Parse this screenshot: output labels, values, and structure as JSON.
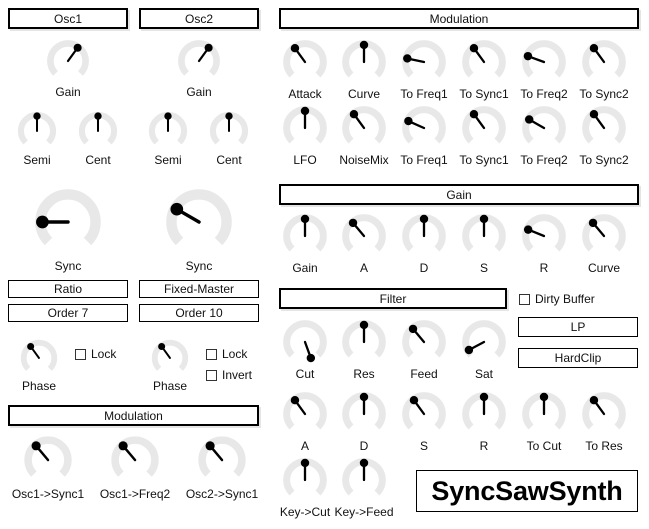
{
  "app": {
    "title": "SyncSawSynth",
    "logo_label": "SyncSawSynth"
  },
  "colors": {
    "background": "#ffffff",
    "knob_arc": "#e8e8e8",
    "knob_needle": "#000000",
    "border": "#000000",
    "text": "#111111"
  },
  "sections": {
    "osc1": {
      "label": "Osc1"
    },
    "osc2": {
      "label": "Osc2"
    },
    "modulation_left": {
      "label": "Modulation"
    },
    "modulation_right": {
      "label": "Modulation"
    },
    "gain": {
      "label": "Gain"
    },
    "filter": {
      "label": "Filter"
    }
  },
  "osc1": {
    "knobs": [
      {
        "name": "gain",
        "label": "Gain",
        "angle": 36
      },
      {
        "name": "semi",
        "label": "Semi",
        "angle": 0
      },
      {
        "name": "cent",
        "label": "Cent",
        "angle": 0
      },
      {
        "name": "sync",
        "label": "Sync",
        "angle": -90
      }
    ],
    "buttons": [
      {
        "name": "sync-type",
        "label": "Ratio"
      },
      {
        "name": "spectrum-order",
        "label": "Order 7"
      }
    ],
    "phase": {
      "name": "phase",
      "label": "Phase",
      "angle": -36
    },
    "checkboxes": [
      {
        "name": "lock",
        "label": "Lock",
        "checked": false
      }
    ]
  },
  "osc2": {
    "knobs": [
      {
        "name": "gain",
        "label": "Gain",
        "angle": 36
      },
      {
        "name": "semi",
        "label": "Semi",
        "angle": 0
      },
      {
        "name": "cent",
        "label": "Cent",
        "angle": 0
      },
      {
        "name": "sync",
        "label": "Sync",
        "angle": -60
      }
    ],
    "buttons": [
      {
        "name": "sync-type",
        "label": "Fixed-Master"
      },
      {
        "name": "spectrum-order",
        "label": "Order 10"
      }
    ],
    "phase": {
      "name": "phase",
      "label": "Phase",
      "angle": -36
    },
    "checkboxes": [
      {
        "name": "lock",
        "label": "Lock",
        "checked": false
      },
      {
        "name": "invert",
        "label": "Invert",
        "checked": false
      }
    ]
  },
  "modulation_left": {
    "knobs": [
      {
        "name": "osc1-to-sync1",
        "label": "Osc1->Sync1",
        "angle": -40
      },
      {
        "name": "osc1-to-freq2",
        "label": "Osc1->Freq2",
        "angle": -40
      },
      {
        "name": "osc2-to-sync1",
        "label": "Osc2->Sync1",
        "angle": -40
      }
    ]
  },
  "modulation_right": {
    "row1": [
      {
        "name": "attack",
        "label": "Attack",
        "angle": -36
      },
      {
        "name": "curve",
        "label": "Curve",
        "angle": 0
      },
      {
        "name": "to-freq1-a",
        "label": "To Freq1",
        "angle": -78
      },
      {
        "name": "to-sync1-a",
        "label": "To Sync1",
        "angle": -36
      },
      {
        "name": "to-freq2-a",
        "label": "To Freq2",
        "angle": -70
      },
      {
        "name": "to-sync2-a",
        "label": "To Sync2",
        "angle": -36
      }
    ],
    "row2": [
      {
        "name": "lfo",
        "label": "LFO",
        "angle": 0
      },
      {
        "name": "noisemix",
        "label": "NoiseMix",
        "angle": -36
      },
      {
        "name": "to-freq1-b",
        "label": "To Freq1",
        "angle": -66
      },
      {
        "name": "to-sync1-b",
        "label": "To Sync1",
        "angle": -36
      },
      {
        "name": "to-freq2-b",
        "label": "To Freq2",
        "angle": -60
      },
      {
        "name": "to-sync2-b",
        "label": "To Sync2",
        "angle": -36
      }
    ]
  },
  "gain_section": {
    "knobs": [
      {
        "name": "gain",
        "label": "Gain",
        "angle": 0
      },
      {
        "name": "attack",
        "label": "A",
        "angle": -40
      },
      {
        "name": "decay",
        "label": "D",
        "angle": 0
      },
      {
        "name": "sustain",
        "label": "S",
        "angle": 0
      },
      {
        "name": "release",
        "label": "R",
        "angle": -68
      },
      {
        "name": "curve",
        "label": "Curve",
        "angle": -40
      }
    ]
  },
  "filter_section": {
    "row1": [
      {
        "name": "cut",
        "label": "Cut",
        "angle": 160
      },
      {
        "name": "res",
        "label": "Res",
        "angle": 0
      },
      {
        "name": "feed",
        "label": "Feed",
        "angle": -40
      },
      {
        "name": "sat",
        "label": "Sat",
        "angle": -118
      }
    ],
    "row2": [
      {
        "name": "attack",
        "label": "A",
        "angle": -36
      },
      {
        "name": "decay",
        "label": "D",
        "angle": 0
      },
      {
        "name": "sustain",
        "label": "S",
        "angle": -36
      },
      {
        "name": "release",
        "label": "R",
        "angle": 0
      },
      {
        "name": "to-cut",
        "label": "To Cut",
        "angle": 0
      },
      {
        "name": "to-res",
        "label": "To Res",
        "angle": -36
      }
    ],
    "row3": [
      {
        "name": "key-to-cut",
        "label": "Key->Cut",
        "angle": 0
      },
      {
        "name": "key-to-feed",
        "label": "Key->Feed",
        "angle": 0
      }
    ],
    "buttons": [
      {
        "name": "filter-type",
        "label": "LP"
      },
      {
        "name": "saturation-type",
        "label": "HardClip"
      }
    ],
    "checkboxes": [
      {
        "name": "dirty-buffer",
        "label": "Dirty Buffer",
        "checked": false
      }
    ]
  }
}
